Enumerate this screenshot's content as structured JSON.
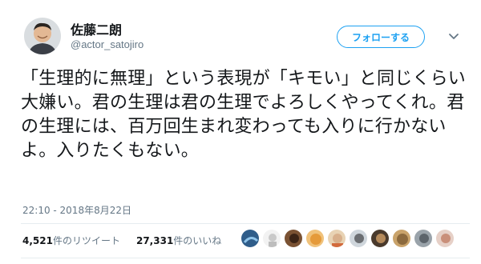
{
  "user": {
    "display_name": "佐藤二朗",
    "handle": "@actor_satojiro"
  },
  "follow_button": {
    "label": "フォローする"
  },
  "tweet": {
    "text": "「生理的に無理」という表現が「キモい」と同じくらい大嫌い。君の生理は君の生理でよろしくやってくれ。君の生理には、百万回生まれ変わっても入りに行かないよ。入りたくもない。",
    "timestamp": "22:10 - 2018年8月22日"
  },
  "stats": {
    "retweet_count": "4,521",
    "retweet_label": "件のリツイート",
    "like_count": "27,331",
    "like_label": "件のいいね"
  },
  "liker_avatars": [
    "avatar-1",
    "avatar-2",
    "avatar-3",
    "avatar-4",
    "avatar-5",
    "avatar-6",
    "avatar-7",
    "avatar-8",
    "avatar-9",
    "avatar-10"
  ],
  "colors": {
    "accent": "#1da1f2",
    "text": "#14171a",
    "secondary_text": "#657786",
    "divider": "#e6ecf0"
  }
}
